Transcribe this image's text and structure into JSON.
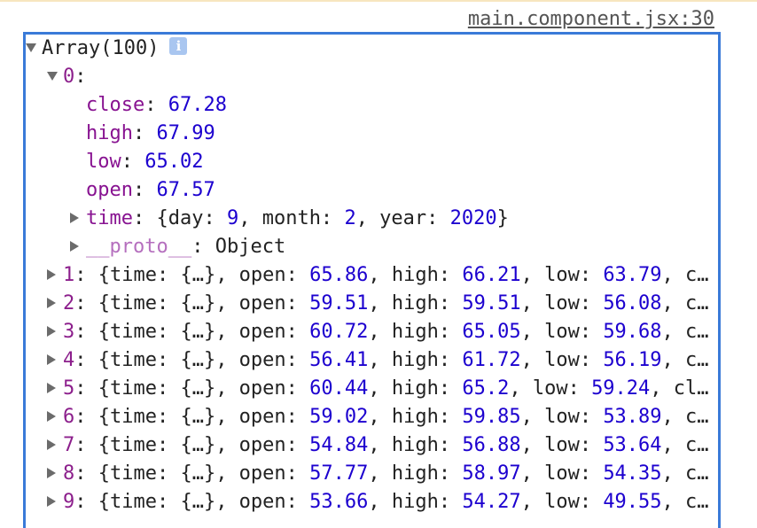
{
  "header": {
    "source_link": "main.component.jsx:30"
  },
  "root": {
    "label": "Array(100)",
    "info_icon": "i"
  },
  "expanded": {
    "index": "0",
    "props": [
      {
        "key": "close",
        "value": "67.28"
      },
      {
        "key": "high",
        "value": "67.99"
      },
      {
        "key": "low",
        "value": "65.02"
      },
      {
        "key": "open",
        "value": "67.57"
      }
    ],
    "time": {
      "key": "time",
      "open": "{day: ",
      "day": "9",
      "sep1": ", month: ",
      "month": "2",
      "sep2": ", year: ",
      "year": "2020",
      "close": "}"
    },
    "proto": {
      "key": "__proto__",
      "value": "Object"
    }
  },
  "items": [
    {
      "index": "1",
      "open": "65.86",
      "high": "66.21",
      "low": "63.79",
      "tail": "cl…"
    },
    {
      "index": "2",
      "open": "59.51",
      "high": "59.51",
      "low": "56.08",
      "tail": "cl…"
    },
    {
      "index": "3",
      "open": "60.72",
      "high": "65.05",
      "low": "59.68",
      "tail": "cl…"
    },
    {
      "index": "4",
      "open": "56.41",
      "high": "61.72",
      "low": "56.19",
      "tail": "cl…"
    },
    {
      "index": "5",
      "open": "60.44",
      "high": "65.2",
      "low": "59.24",
      "tail": "clo…"
    },
    {
      "index": "6",
      "open": "59.02",
      "high": "59.85",
      "low": "53.89",
      "tail": "cl…"
    },
    {
      "index": "7",
      "open": "54.84",
      "high": "56.88",
      "low": "53.64",
      "tail": "cl…"
    },
    {
      "index": "8",
      "open": "57.77",
      "high": "58.97",
      "low": "54.35",
      "tail": "cl…"
    },
    {
      "index": "9",
      "open": "53.66",
      "high": "54.27",
      "low": "49.55",
      "tail": "cl…"
    }
  ],
  "labels": {
    "colon": ":",
    "item_prefix": ": {time: {…}, open: ",
    "high_label": ", high: ",
    "low_label": ", low: ",
    "sep": ", "
  },
  "colors": {
    "frame_border": "#3a7ad8",
    "index": "#8c1f8c",
    "key": "#881391",
    "number": "#1c00cf",
    "info_badge": "#a9c6f0"
  }
}
